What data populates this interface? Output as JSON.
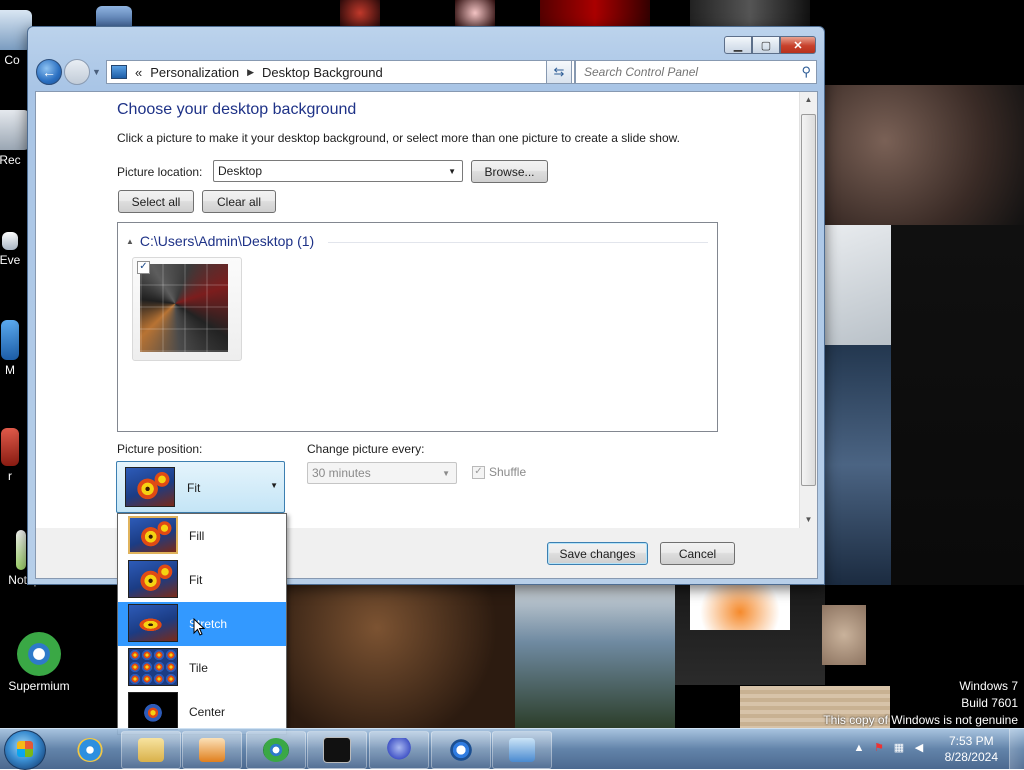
{
  "desktop": {
    "icons": [
      {
        "label": "Co"
      },
      {
        "label": "Rec"
      },
      {
        "label": "Eve"
      },
      {
        "label": "M"
      },
      {
        "label": "r"
      },
      {
        "label": "Notepad++"
      },
      {
        "label": "Supermium"
      }
    ],
    "watermark": {
      "line1": "Windows 7",
      "line2": "Build 7601",
      "line3": "This copy of Windows is not genuine"
    }
  },
  "window": {
    "address": {
      "overflow": "«",
      "crumbs": [
        "Personalization",
        "Desktop Background"
      ]
    },
    "search": {
      "placeholder": "Search Control Panel"
    },
    "page": {
      "title": "Choose your desktop background",
      "subtitle": "Click a picture to make it your desktop background, or select more than one picture to create a slide show.",
      "picture_location_label": "Picture location:",
      "picture_location_value": "Desktop",
      "browse_button": "Browse...",
      "select_all_button": "Select all",
      "clear_all_button": "Clear all",
      "group_header": "C:\\Users\\Admin\\Desktop (1)",
      "thumbnail_checked": "✓",
      "picture_position_label": "Picture position:",
      "picture_position_value": "Fit",
      "change_picture_label": "Change picture every:",
      "change_picture_value": "30 minutes",
      "shuffle_label": "Shuffle",
      "shuffle_checked": "✓"
    },
    "footer": {
      "save_button": "Save changes",
      "cancel_button": "Cancel"
    }
  },
  "position_dropdown": {
    "options": [
      {
        "label": "Fill"
      },
      {
        "label": "Fit"
      },
      {
        "label": "Stretch"
      },
      {
        "label": "Tile"
      },
      {
        "label": "Center"
      }
    ],
    "highlighted": "Stretch"
  },
  "taskbar": {
    "clock": {
      "time": "7:53 PM",
      "date": "8/28/2024"
    }
  }
}
